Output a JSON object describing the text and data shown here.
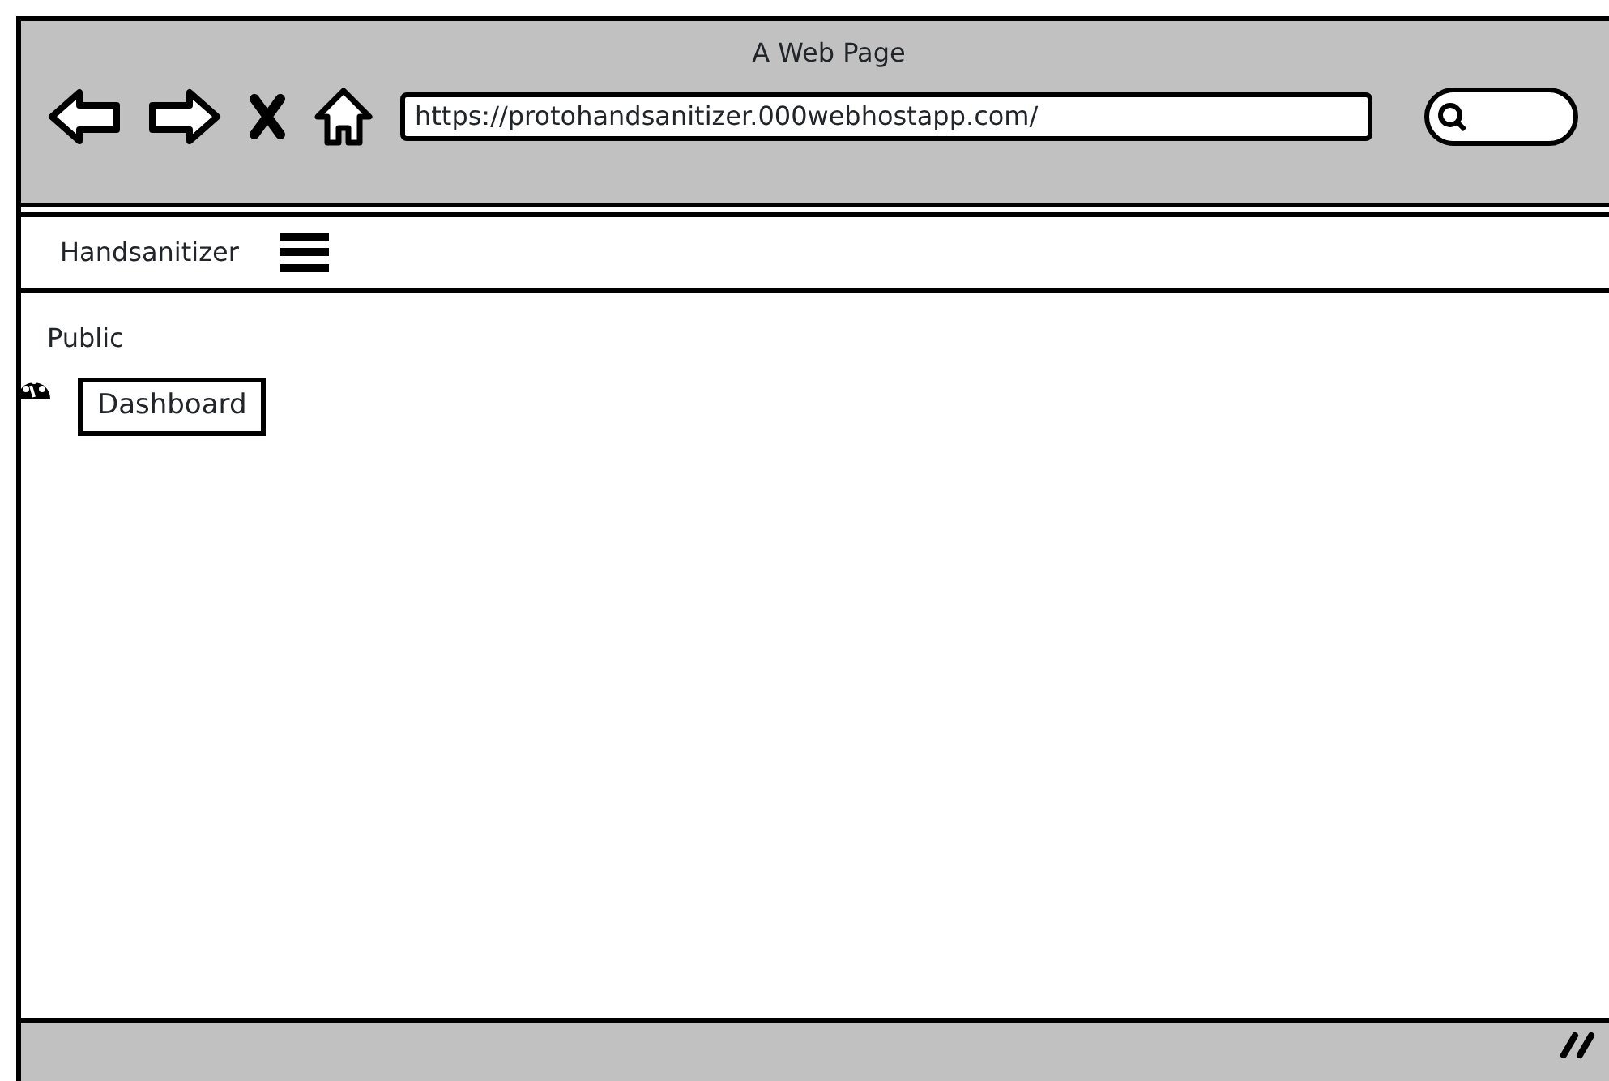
{
  "window": {
    "title": "A Web Page"
  },
  "browser": {
    "address": "https://protohandsanitizer.000webhostapp.com/"
  },
  "navbar": {
    "brand": "Handsanitizer"
  },
  "sidebar": {
    "heading": "Public",
    "items": [
      {
        "label": "Dashboard",
        "kind": "boxed"
      }
    ]
  }
}
